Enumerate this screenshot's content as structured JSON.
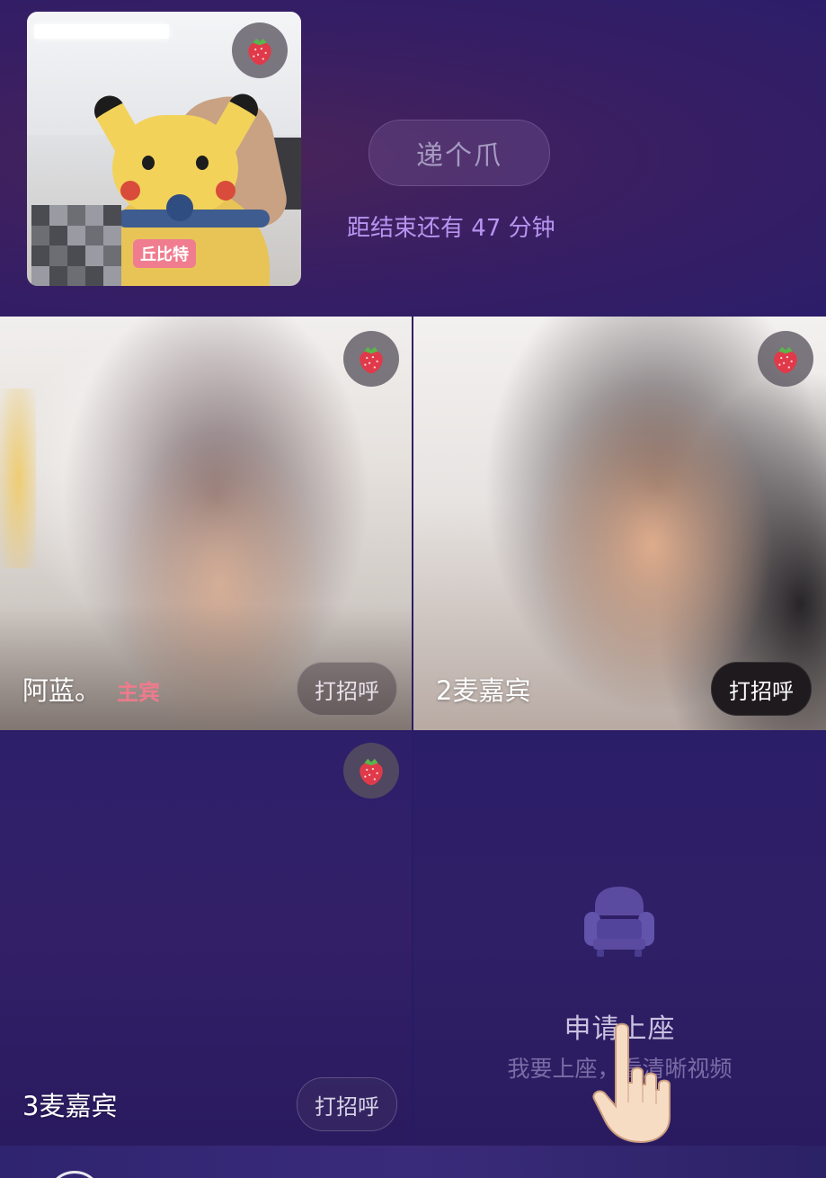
{
  "header": {
    "host_tag": "丘比特",
    "claw_button_label": "递个爪",
    "countdown_text": "距结束还有 47 分钟"
  },
  "tiles": [
    {
      "name": "阿蓝。",
      "badge": "主宾",
      "greet_label": "打招呼"
    },
    {
      "name": "2麦嘉宾",
      "greet_label": "打招呼"
    },
    {
      "name": "3麦嘉宾",
      "greet_label": "打招呼"
    }
  ],
  "seat": {
    "title": "申请上座",
    "subtitle": "我要上座，看清晰视频"
  },
  "icons": {
    "gift": "strawberry-icon",
    "seat": "sofa-icon",
    "pointer": "hand-pointer-icon"
  },
  "colors": {
    "background": "#2b1c66",
    "countdown": "#b794f0",
    "host_badge": "#f07a8c"
  }
}
